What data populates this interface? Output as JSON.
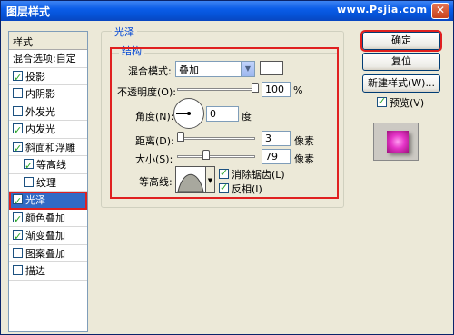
{
  "window": {
    "title": "图层样式",
    "watermark": "www.Psjia.com",
    "close_label": "✕"
  },
  "styles_list": {
    "header": "样式",
    "items": [
      {
        "label": "混合选项:自定",
        "checkbox": false,
        "checked": false,
        "sub": false,
        "selected": false
      },
      {
        "label": "投影",
        "checkbox": true,
        "checked": true,
        "sub": false,
        "selected": false
      },
      {
        "label": "内阴影",
        "checkbox": true,
        "checked": false,
        "sub": false,
        "selected": false
      },
      {
        "label": "外发光",
        "checkbox": true,
        "checked": false,
        "sub": false,
        "selected": false
      },
      {
        "label": "内发光",
        "checkbox": true,
        "checked": true,
        "sub": false,
        "selected": false
      },
      {
        "label": "斜面和浮雕",
        "checkbox": true,
        "checked": true,
        "sub": false,
        "selected": false
      },
      {
        "label": "等高线",
        "checkbox": true,
        "checked": true,
        "sub": true,
        "selected": false
      },
      {
        "label": "纹理",
        "checkbox": true,
        "checked": false,
        "sub": true,
        "selected": false
      },
      {
        "label": "光泽",
        "checkbox": true,
        "checked": true,
        "sub": false,
        "selected": true
      },
      {
        "label": "颜色叠加",
        "checkbox": true,
        "checked": true,
        "sub": false,
        "selected": false
      },
      {
        "label": "渐变叠加",
        "checkbox": true,
        "checked": true,
        "sub": false,
        "selected": false
      },
      {
        "label": "图案叠加",
        "checkbox": true,
        "checked": false,
        "sub": false,
        "selected": false
      },
      {
        "label": "描边",
        "checkbox": true,
        "checked": false,
        "sub": false,
        "selected": false
      }
    ]
  },
  "satin": {
    "group_title": "光泽",
    "structure_title": "结构",
    "blend_mode_label": "混合模式:",
    "blend_mode_value": "叠加",
    "opacity_label": "不透明度(O):",
    "opacity_value": "100",
    "opacity_unit": "%",
    "angle_label": "角度(N):",
    "angle_value": "0",
    "angle_unit": "度",
    "distance_label": "距离(D):",
    "distance_value": "3",
    "distance_unit": "像素",
    "size_label": "大小(S):",
    "size_value": "79",
    "size_unit": "像素",
    "contour_label": "等高线:",
    "antialias_label": "消除锯齿(L)",
    "antialias_checked": true,
    "invert_label": "反相(I)",
    "invert_checked": true
  },
  "buttons": {
    "ok": "确定",
    "reset": "复位",
    "new_style": "新建样式(W)...",
    "preview_label": "预览(V)",
    "preview_checked": true
  },
  "colors": {
    "title_bar": "#0553d8",
    "highlight_border": "#e02020",
    "selected_row": "#316ac5",
    "preview_swatch": "#e535c8"
  }
}
